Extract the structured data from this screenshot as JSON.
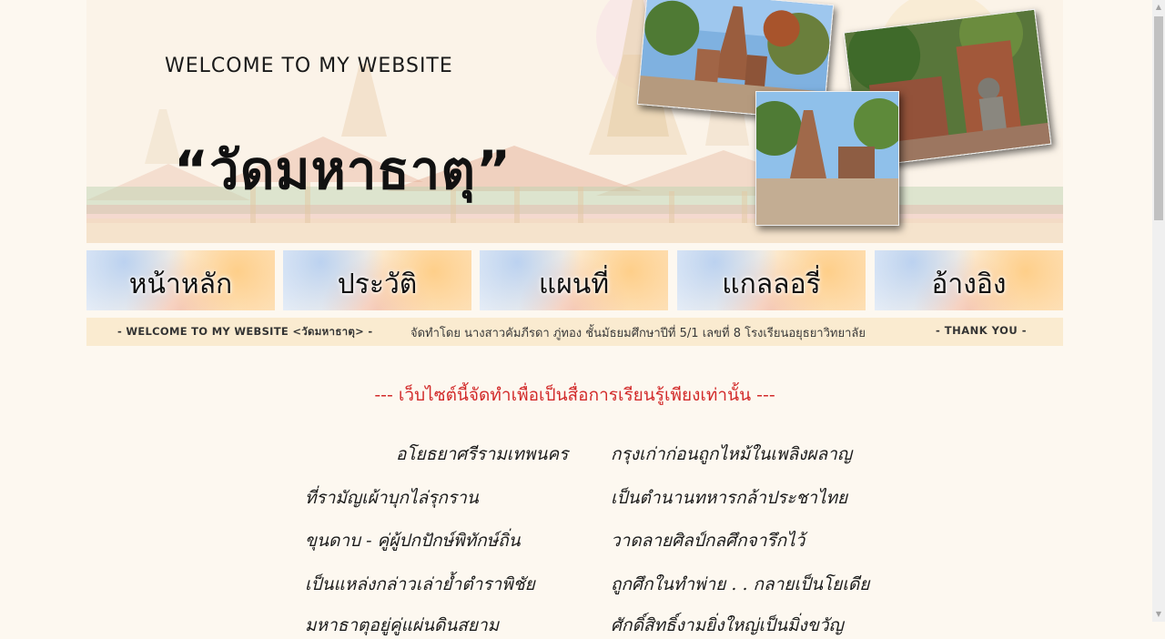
{
  "banner": {
    "welcome": "WELCOME TO MY WEBSITE",
    "title": "“วัดมหาธาตุ”",
    "photos": [
      "temple-ruins-photo",
      "prang-tower-photo",
      "buddha-statue-photo"
    ]
  },
  "nav": {
    "items": [
      {
        "label": "หน้าหลัก"
      },
      {
        "label": "ประวัติ"
      },
      {
        "label": "แผนที่"
      },
      {
        "label": "แกลลอรี่"
      },
      {
        "label": "อ้างอิง"
      }
    ]
  },
  "strip": {
    "left": "- WELCOME TO MY WEBSITE <วัดมหาธาตุ> -",
    "middle": "จัดทำโดย นางสาวคัมภีรดา ภู่ทอง ชั้นมัธยมศึกษาปีที่ 5/1 เลขที่ 8 โรงเรียนอยุธยาวิทยาลัย",
    "right": "- THANK YOU -"
  },
  "content": {
    "notice": "--- เว็บไซต์นี้จัดทำเพื่อเป็นสื่อการเรียนรู้เพียงเท่านั้น ---",
    "poem": [
      {
        "left": "อโยธยาศรีรามเทพนคร",
        "right": "กรุงเก่าก่อนถูกไหม้ในเพลิงผลาญ"
      },
      {
        "left": "ที่รามัญเผ้าบุกไล่รุกราน",
        "right": "เป็นตำนานทหารกล้าประชาไทย"
      },
      {
        "left": "ขุนดาบ - คู่ผู้ปกปักษ์พิทักษ์ถิ่น",
        "right": "วาดลายศิลป์กลศึกจารึกไว้"
      },
      {
        "left": "เป็นแหล่งกล่าวเล่าย้ำตำราพิชัย",
        "right": "ถูกศึกในทำพ่าย . . กลายเป็นโยเดีย"
      },
      {
        "left": "มหาธาตุอยู่คู่แผ่นดินสยาม",
        "right": "ศักดิ์สิทธิ์งามยิ่งใหญ่เป็นมิ่งขวัญ"
      }
    ]
  },
  "colors": {
    "background": "#fdf8f0",
    "notice": "#d22a2a",
    "strip": "#faebd0"
  }
}
